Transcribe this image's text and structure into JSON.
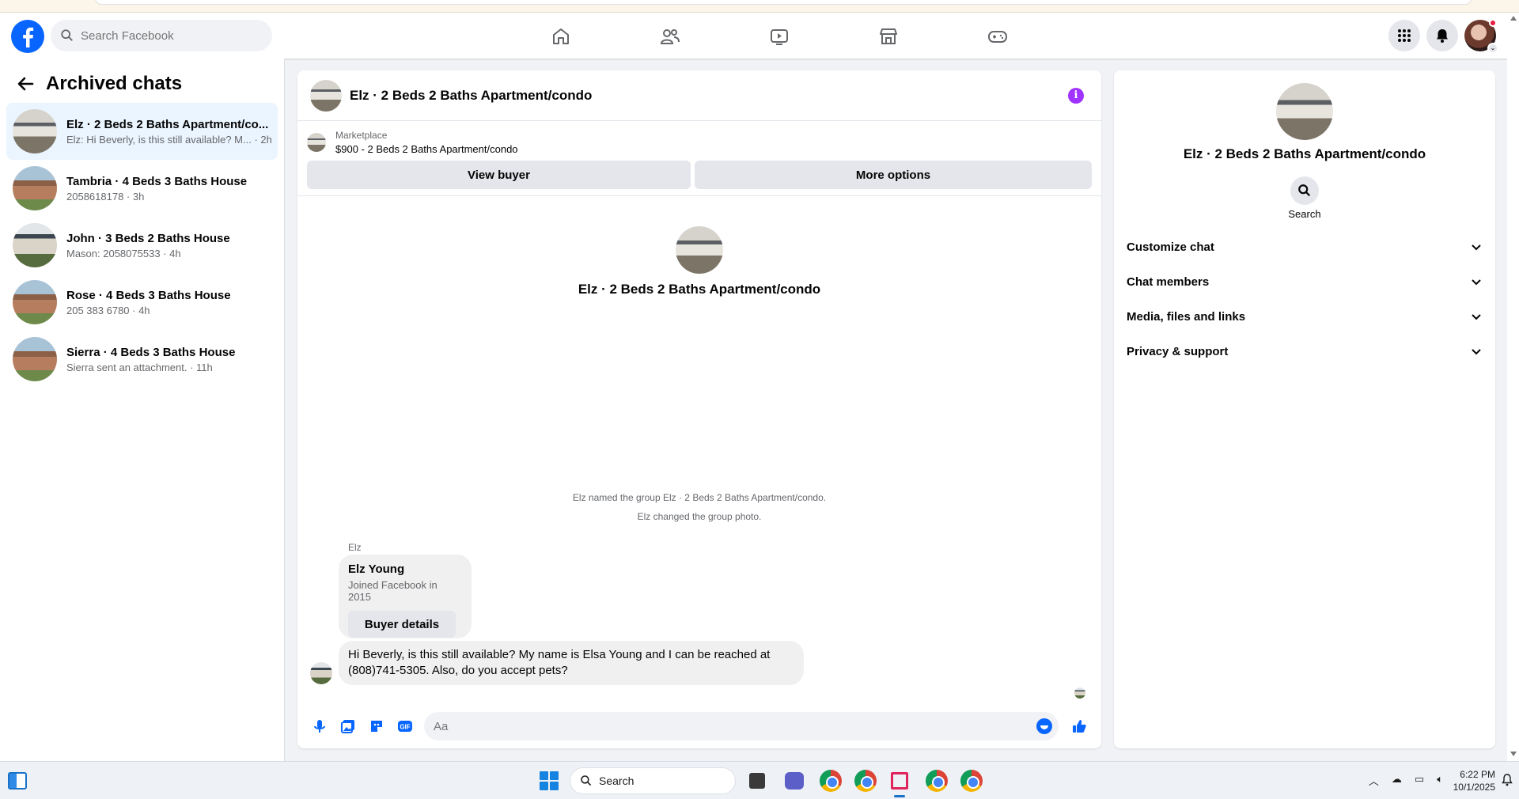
{
  "search": {
    "placeholder": "Search Facebook"
  },
  "nav": {
    "items": [
      "home-icon",
      "friends-icon",
      "video-icon",
      "marketplace-icon",
      "gaming-icon"
    ]
  },
  "left": {
    "title": "Archived chats",
    "chats": [
      {
        "name": "Elz · 2 Beds 2 Baths Apartment/co...",
        "sub": "Elz: Hi Beverly, is this still available? M... · 2h"
      },
      {
        "name": "Tambria · 4 Beds 3 Baths House",
        "sub": "2058618178 · 3h"
      },
      {
        "name": "John · 3 Beds 2 Baths House",
        "sub": "Mason: 2058075533 · 4h"
      },
      {
        "name": "Rose · 4 Beds 3 Baths House",
        "sub": "205 383 6780 · 4h"
      },
      {
        "name": "Sierra · 4 Beds 3 Baths House",
        "sub": "Sierra sent an attachment. · 11h"
      }
    ]
  },
  "conversation": {
    "title": "Elz · 2 Beds 2 Baths Apartment/condo",
    "marketplace_label": "Marketplace",
    "listing": "$900 - 2 Beds 2 Baths Apartment/condo",
    "view_buyer": "View buyer",
    "more_options": "More options",
    "intro_title": "Elz · 2 Beds 2 Baths Apartment/condo",
    "sys1": "Elz named the group Elz · 2 Beds 2 Baths Apartment/condo.",
    "sys2": "Elz changed the group photo.",
    "sender": "Elz",
    "buyer_name": "Elz Young",
    "buyer_joined": "Joined Facebook in 2015",
    "buyer_details": "Buyer details",
    "message": "Hi Beverly, is this still available? My name is Elsa Young and I can be reached at (808)741-5305. Also, do you accept pets?",
    "composer_placeholder": "Aa"
  },
  "details": {
    "title": "Elz · 2 Beds 2 Baths Apartment/condo",
    "search_label": "Search",
    "sections": [
      "Customize chat",
      "Chat members",
      "Media, files and links",
      "Privacy & support"
    ]
  },
  "taskbar": {
    "search_label": "Search",
    "time": "6:22 PM",
    "date": "10/1/2025"
  },
  "colors": {
    "accent": "#0866ff",
    "info": "#a033ff",
    "active_row": "#ebf5ff"
  }
}
